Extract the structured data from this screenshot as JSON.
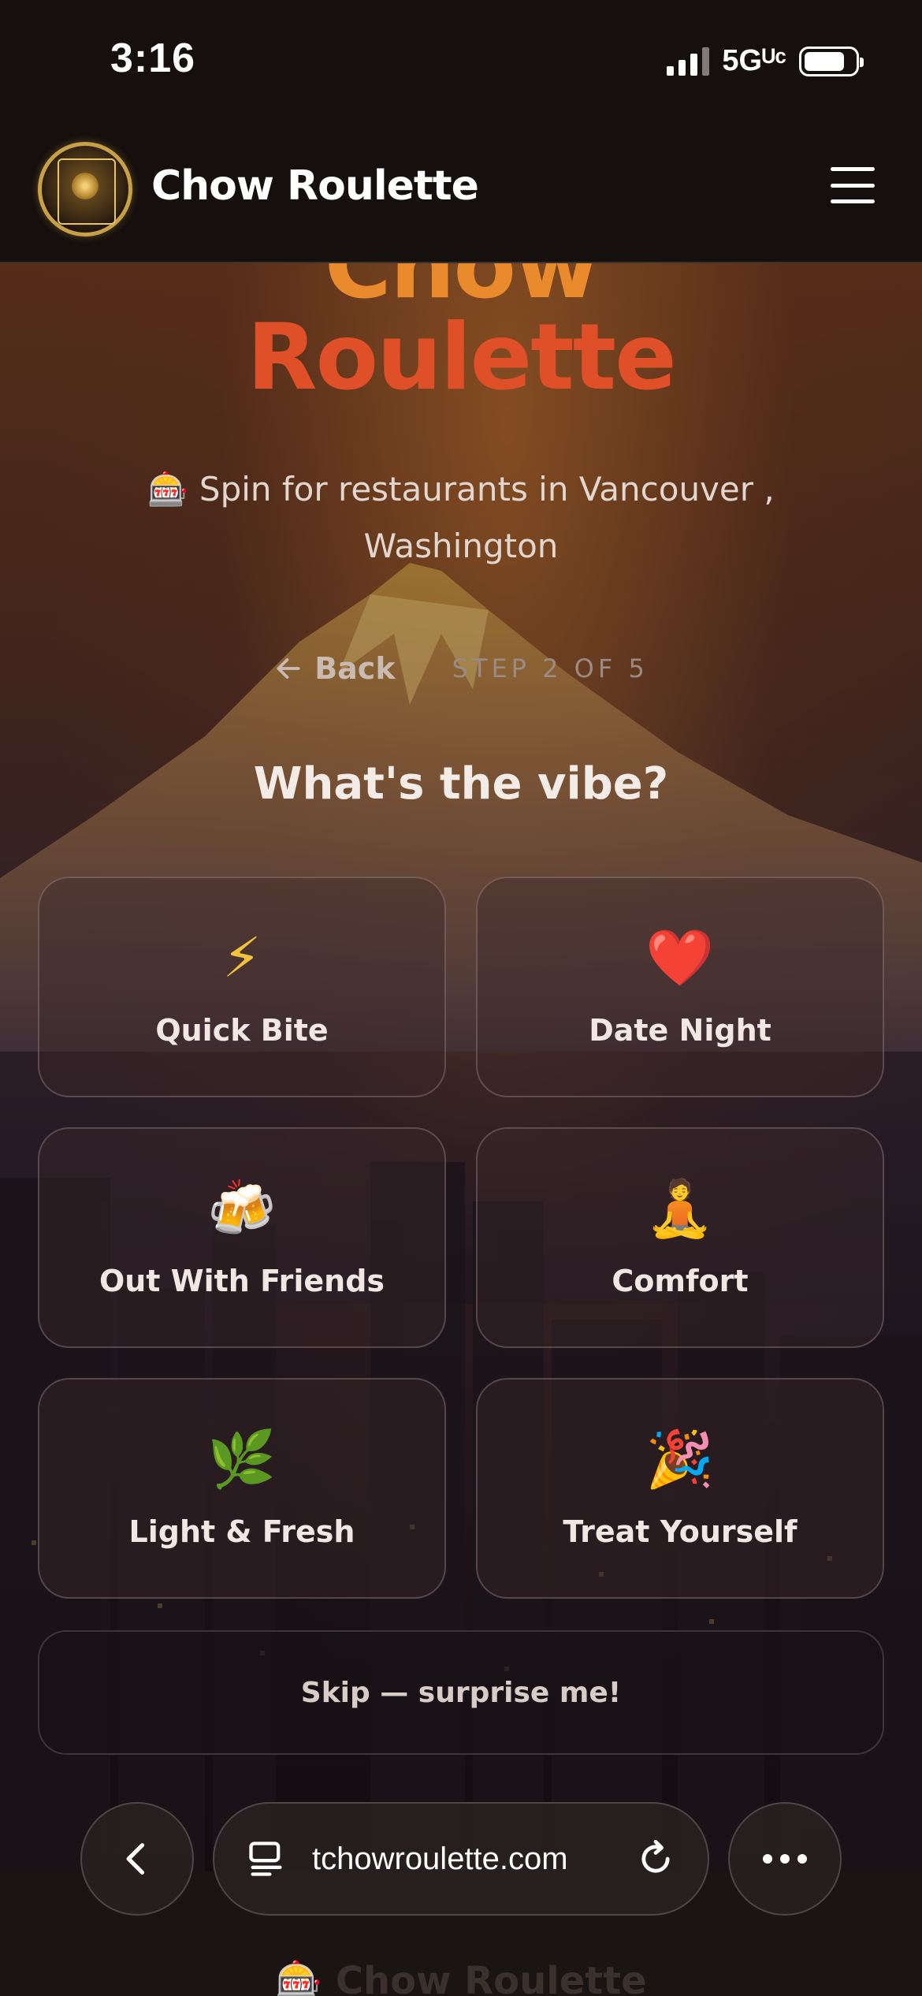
{
  "status_bar": {
    "time": "3:16",
    "network": "5Gᵁᶜ"
  },
  "header": {
    "brand": "Chow Roulette"
  },
  "hero": {
    "title_line1": "Chow",
    "title_line2": "Roulette",
    "subtitle": "🎰 Spin for restaurants in Vancouver , Washington"
  },
  "nav": {
    "back_label": "Back",
    "step_label": "STEP 2 OF 5"
  },
  "question": "What's the vibe?",
  "options": [
    {
      "emoji": "⚡",
      "label": "Quick Bite"
    },
    {
      "emoji": "❤️",
      "label": "Date Night"
    },
    {
      "emoji": "🍻",
      "label": "Out With Friends"
    },
    {
      "emoji": "🧘",
      "label": "Comfort"
    },
    {
      "emoji": "🌿",
      "label": "Light & Fresh"
    },
    {
      "emoji": "🎉",
      "label": "Treat Yourself"
    }
  ],
  "skip_label": "Skip — surprise me!",
  "browser": {
    "url": "tchowroulette.com"
  },
  "footer_ghost": "🎰 Chow Roulette",
  "colors": {
    "accent_orange": "#e98a2c",
    "accent_red": "#df4f28",
    "background": "#150f0d"
  },
  "icons": [
    "menu-icon",
    "back-arrow-icon",
    "chevron-left-icon",
    "tabs-icon",
    "reload-icon",
    "more-icon"
  ]
}
